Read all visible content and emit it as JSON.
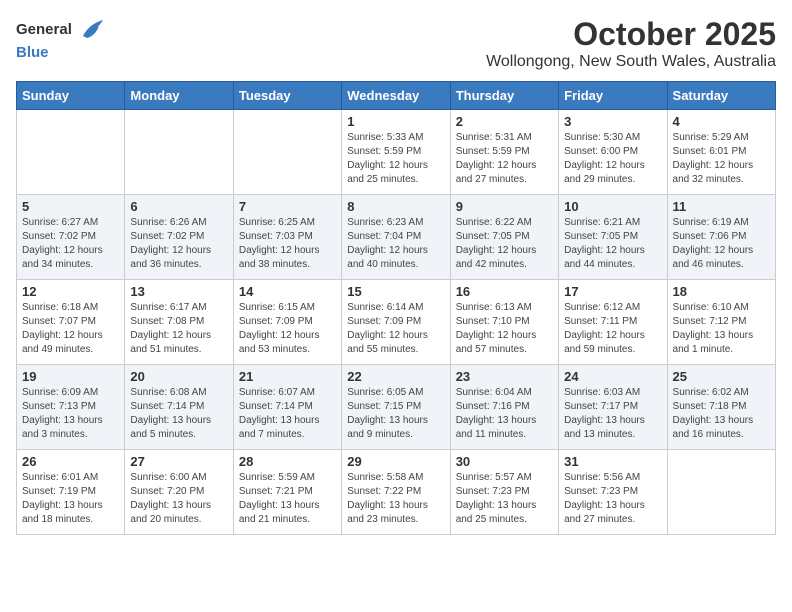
{
  "header": {
    "logo_general": "General",
    "logo_blue": "Blue",
    "month": "October 2025",
    "location": "Wollongong, New South Wales, Australia"
  },
  "days_of_week": [
    "Sunday",
    "Monday",
    "Tuesday",
    "Wednesday",
    "Thursday",
    "Friday",
    "Saturday"
  ],
  "weeks": [
    [
      {
        "day": "",
        "sunrise": "",
        "sunset": "",
        "daylight": ""
      },
      {
        "day": "",
        "sunrise": "",
        "sunset": "",
        "daylight": ""
      },
      {
        "day": "",
        "sunrise": "",
        "sunset": "",
        "daylight": ""
      },
      {
        "day": "1",
        "sunrise": "Sunrise: 5:33 AM",
        "sunset": "Sunset: 5:59 PM",
        "daylight": "Daylight: 12 hours and 25 minutes."
      },
      {
        "day": "2",
        "sunrise": "Sunrise: 5:31 AM",
        "sunset": "Sunset: 5:59 PM",
        "daylight": "Daylight: 12 hours and 27 minutes."
      },
      {
        "day": "3",
        "sunrise": "Sunrise: 5:30 AM",
        "sunset": "Sunset: 6:00 PM",
        "daylight": "Daylight: 12 hours and 29 minutes."
      },
      {
        "day": "4",
        "sunrise": "Sunrise: 5:29 AM",
        "sunset": "Sunset: 6:01 PM",
        "daylight": "Daylight: 12 hours and 32 minutes."
      }
    ],
    [
      {
        "day": "5",
        "sunrise": "Sunrise: 6:27 AM",
        "sunset": "Sunset: 7:02 PM",
        "daylight": "Daylight: 12 hours and 34 minutes."
      },
      {
        "day": "6",
        "sunrise": "Sunrise: 6:26 AM",
        "sunset": "Sunset: 7:02 PM",
        "daylight": "Daylight: 12 hours and 36 minutes."
      },
      {
        "day": "7",
        "sunrise": "Sunrise: 6:25 AM",
        "sunset": "Sunset: 7:03 PM",
        "daylight": "Daylight: 12 hours and 38 minutes."
      },
      {
        "day": "8",
        "sunrise": "Sunrise: 6:23 AM",
        "sunset": "Sunset: 7:04 PM",
        "daylight": "Daylight: 12 hours and 40 minutes."
      },
      {
        "day": "9",
        "sunrise": "Sunrise: 6:22 AM",
        "sunset": "Sunset: 7:05 PM",
        "daylight": "Daylight: 12 hours and 42 minutes."
      },
      {
        "day": "10",
        "sunrise": "Sunrise: 6:21 AM",
        "sunset": "Sunset: 7:05 PM",
        "daylight": "Daylight: 12 hours and 44 minutes."
      },
      {
        "day": "11",
        "sunrise": "Sunrise: 6:19 AM",
        "sunset": "Sunset: 7:06 PM",
        "daylight": "Daylight: 12 hours and 46 minutes."
      }
    ],
    [
      {
        "day": "12",
        "sunrise": "Sunrise: 6:18 AM",
        "sunset": "Sunset: 7:07 PM",
        "daylight": "Daylight: 12 hours and 49 minutes."
      },
      {
        "day": "13",
        "sunrise": "Sunrise: 6:17 AM",
        "sunset": "Sunset: 7:08 PM",
        "daylight": "Daylight: 12 hours and 51 minutes."
      },
      {
        "day": "14",
        "sunrise": "Sunrise: 6:15 AM",
        "sunset": "Sunset: 7:09 PM",
        "daylight": "Daylight: 12 hours and 53 minutes."
      },
      {
        "day": "15",
        "sunrise": "Sunrise: 6:14 AM",
        "sunset": "Sunset: 7:09 PM",
        "daylight": "Daylight: 12 hours and 55 minutes."
      },
      {
        "day": "16",
        "sunrise": "Sunrise: 6:13 AM",
        "sunset": "Sunset: 7:10 PM",
        "daylight": "Daylight: 12 hours and 57 minutes."
      },
      {
        "day": "17",
        "sunrise": "Sunrise: 6:12 AM",
        "sunset": "Sunset: 7:11 PM",
        "daylight": "Daylight: 12 hours and 59 minutes."
      },
      {
        "day": "18",
        "sunrise": "Sunrise: 6:10 AM",
        "sunset": "Sunset: 7:12 PM",
        "daylight": "Daylight: 13 hours and 1 minute."
      }
    ],
    [
      {
        "day": "19",
        "sunrise": "Sunrise: 6:09 AM",
        "sunset": "Sunset: 7:13 PM",
        "daylight": "Daylight: 13 hours and 3 minutes."
      },
      {
        "day": "20",
        "sunrise": "Sunrise: 6:08 AM",
        "sunset": "Sunset: 7:14 PM",
        "daylight": "Daylight: 13 hours and 5 minutes."
      },
      {
        "day": "21",
        "sunrise": "Sunrise: 6:07 AM",
        "sunset": "Sunset: 7:14 PM",
        "daylight": "Daylight: 13 hours and 7 minutes."
      },
      {
        "day": "22",
        "sunrise": "Sunrise: 6:05 AM",
        "sunset": "Sunset: 7:15 PM",
        "daylight": "Daylight: 13 hours and 9 minutes."
      },
      {
        "day": "23",
        "sunrise": "Sunrise: 6:04 AM",
        "sunset": "Sunset: 7:16 PM",
        "daylight": "Daylight: 13 hours and 11 minutes."
      },
      {
        "day": "24",
        "sunrise": "Sunrise: 6:03 AM",
        "sunset": "Sunset: 7:17 PM",
        "daylight": "Daylight: 13 hours and 13 minutes."
      },
      {
        "day": "25",
        "sunrise": "Sunrise: 6:02 AM",
        "sunset": "Sunset: 7:18 PM",
        "daylight": "Daylight: 13 hours and 16 minutes."
      }
    ],
    [
      {
        "day": "26",
        "sunrise": "Sunrise: 6:01 AM",
        "sunset": "Sunset: 7:19 PM",
        "daylight": "Daylight: 13 hours and 18 minutes."
      },
      {
        "day": "27",
        "sunrise": "Sunrise: 6:00 AM",
        "sunset": "Sunset: 7:20 PM",
        "daylight": "Daylight: 13 hours and 20 minutes."
      },
      {
        "day": "28",
        "sunrise": "Sunrise: 5:59 AM",
        "sunset": "Sunset: 7:21 PM",
        "daylight": "Daylight: 13 hours and 21 minutes."
      },
      {
        "day": "29",
        "sunrise": "Sunrise: 5:58 AM",
        "sunset": "Sunset: 7:22 PM",
        "daylight": "Daylight: 13 hours and 23 minutes."
      },
      {
        "day": "30",
        "sunrise": "Sunrise: 5:57 AM",
        "sunset": "Sunset: 7:23 PM",
        "daylight": "Daylight: 13 hours and 25 minutes."
      },
      {
        "day": "31",
        "sunrise": "Sunrise: 5:56 AM",
        "sunset": "Sunset: 7:23 PM",
        "daylight": "Daylight: 13 hours and 27 minutes."
      },
      {
        "day": "",
        "sunrise": "",
        "sunset": "",
        "daylight": ""
      }
    ]
  ]
}
